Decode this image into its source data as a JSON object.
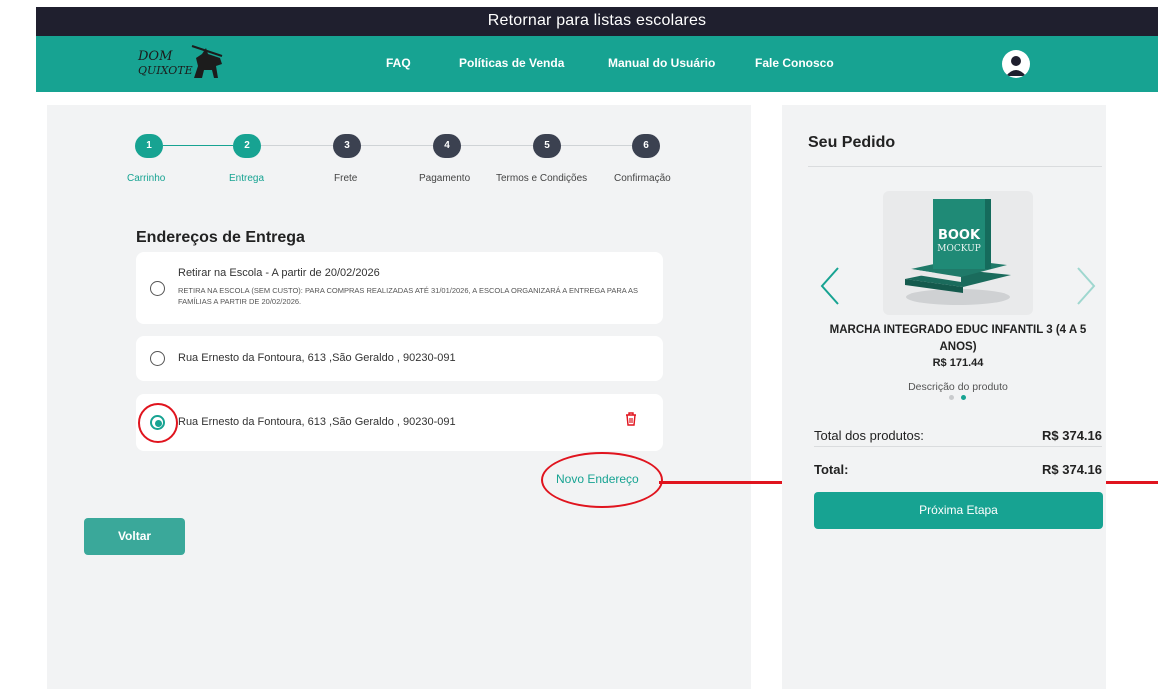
{
  "topbar": {
    "back_to_lists": "Retornar para listas escolares"
  },
  "navbar": {
    "logo": "Dom Quixote",
    "links": [
      "FAQ",
      "Políticas de Venda",
      "Manual do Usuário",
      "Fale Conosco"
    ],
    "user_icon": "user-avatar-icon"
  },
  "steps": [
    {
      "number": "1",
      "label": "Carrinho",
      "state": "done"
    },
    {
      "number": "2",
      "label": "Entrega",
      "state": "done"
    },
    {
      "number": "3",
      "label": "Frete",
      "state": "todo"
    },
    {
      "number": "4",
      "label": "Pagamento",
      "state": "todo"
    },
    {
      "number": "5",
      "label": "Termos e Condições",
      "state": "todo"
    },
    {
      "number": "6",
      "label": "Confirmação",
      "state": "todo"
    }
  ],
  "delivery": {
    "title": "Endereços de Entrega",
    "addresses": [
      {
        "title": "Retirar na Escola - A partir de 20/02/2026",
        "description": "Retira na escola (sem custo): para compras realizadas até 31/01/2026, a escola organizará a entrega para as famílias a partir de 20/02/2026.",
        "selected": false
      },
      {
        "title": "Rua Ernesto da Fontoura, 613 ,São Geraldo , 90230-091",
        "selected": false
      },
      {
        "title": "Rua Ernesto da Fontoura, 613 ,São Geraldo , 90230-091",
        "selected": true,
        "deletable": true
      }
    ],
    "new_address": "Novo Endereço"
  },
  "back_button": "Voltar",
  "order": {
    "title": "Seu Pedido",
    "product": {
      "image_text_1": "BOOK",
      "image_text_2": "MOCKUP",
      "name": "MARCHA INTEGRADO EDUC INFANTIL 3 (4 A 5 ANOS)",
      "price": "R$ 171.44",
      "description": "Descrição do produto"
    },
    "carousel": {
      "slides": 2,
      "active": 2
    },
    "total_products_label": "Total dos produtos:",
    "total_products_value": "R$ 374.16",
    "total_label": "Total:",
    "total_value": "R$ 374.16",
    "next_button": "Próxima Etapa"
  },
  "colors": {
    "accent": "#17a392",
    "dark": "#1f1f2e",
    "highlight": "#e0141e",
    "delete": "#e0141e"
  }
}
